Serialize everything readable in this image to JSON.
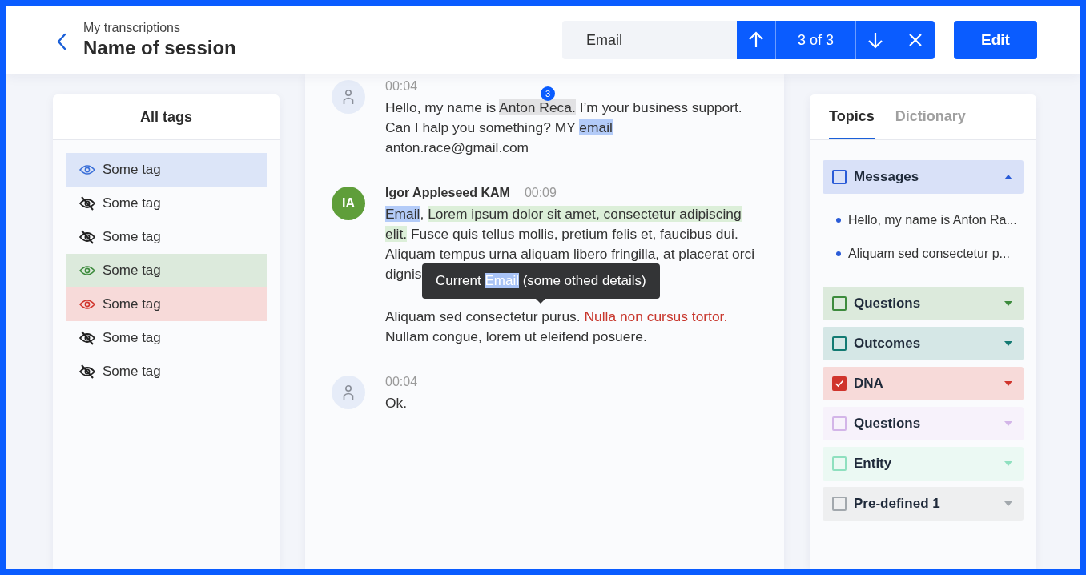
{
  "header": {
    "breadcrumb": "My transcriptions",
    "title": "Name of session"
  },
  "search": {
    "value": "Email",
    "counter": "3 of 3"
  },
  "edit_button": "Edit",
  "tags_panel": {
    "title": "All tags",
    "tags": [
      {
        "label": "Some tag",
        "visible": true,
        "color": "#3a6fd8"
      },
      {
        "label": "Some tag",
        "visible": false,
        "color": "#222222"
      },
      {
        "label": "Some tag",
        "visible": false,
        "color": "#222222"
      },
      {
        "label": "Some tag",
        "visible": true,
        "color": "#3d8b3d"
      },
      {
        "label": "Some tag",
        "visible": true,
        "color": "#d0342c"
      },
      {
        "label": "Some tag",
        "visible": false,
        "color": "#222222"
      },
      {
        "label": "Some tag",
        "visible": false,
        "color": "#222222"
      }
    ]
  },
  "messages": [
    {
      "avatar": {
        "kind": "icon"
      },
      "time": "00:04",
      "paragraphs": [
        [
          {
            "kind": "plain",
            "text": "Hello, my name is "
          },
          {
            "kind": "highlight",
            "text": "Anton Reca.",
            "color": "#e2e2e4",
            "badge": "3"
          },
          {
            "kind": "plain",
            "text": " I’m your business support. Can I halp you something? MY "
          },
          {
            "kind": "match",
            "text": "email"
          },
          {
            "kind": "plain",
            "text": " anton.race@gmail.com"
          }
        ]
      ]
    },
    {
      "avatar": {
        "kind": "initials",
        "text": "IA"
      },
      "author": "Igor Appleseed KAM",
      "time": "00:09",
      "paragraphs": [
        [
          {
            "kind": "match",
            "text": "Email"
          },
          {
            "kind": "plain",
            "text": ", "
          },
          {
            "kind": "highlight",
            "text": "Lorem ipsum dolor sit amet, consectetur adipiscing elit.",
            "color": "#dcefd9"
          },
          {
            "kind": "plain",
            "text": " Fusce quis tellus mollis, pretium felis et, faucibus dui. Aliquam tempus urna aliquam libero fringilla, at placerat orci dignis"
          }
        ],
        [
          {
            "kind": "plain",
            "text": "Aliquam sed consectetur purus. "
          },
          {
            "kind": "colored",
            "text": "Nulla non cursus tortor.",
            "color": "#c8372d"
          },
          {
            "kind": "plain",
            "text": " Nullam congue, lorem ut eleifend posuere."
          }
        ]
      ],
      "tooltip": [
        {
          "kind": "plain",
          "text": "Current "
        },
        {
          "kind": "match",
          "text": "Email"
        },
        {
          "kind": "plain",
          "text": " (some othed details)"
        }
      ]
    },
    {
      "avatar": {
        "kind": "icon"
      },
      "time": "00:04",
      "paragraphs": [
        [
          {
            "kind": "plain",
            "text": "Ok."
          }
        ]
      ]
    }
  ],
  "topics_panel": {
    "tabs": [
      {
        "label": "Topics",
        "selected": true
      },
      {
        "label": "Dictionary",
        "selected": false
      }
    ],
    "topics": [
      {
        "name": "Messages",
        "color": "#2a5bd7",
        "checked": false,
        "expanded": true,
        "items": [
          "Hello, my name is Anton Ra...",
          "Aliquam sed consectetur p..."
        ]
      },
      {
        "name": "Questions",
        "color": "#3d8b3d",
        "checked": false,
        "expanded": false
      },
      {
        "name": "Outcomes",
        "color": "#137a72",
        "checked": false,
        "expanded": false
      },
      {
        "name": "DNA",
        "color": "#d0342c",
        "checked": true,
        "expanded": false
      },
      {
        "name": "Questions",
        "color": "#d3b5e8",
        "checked": false,
        "expanded": false
      },
      {
        "name": "Entity",
        "color": "#8fe0bf",
        "checked": false,
        "expanded": false
      },
      {
        "name": "Pre-defined 1",
        "color": "#a2a8ad",
        "checked": false,
        "expanded": false
      }
    ]
  }
}
